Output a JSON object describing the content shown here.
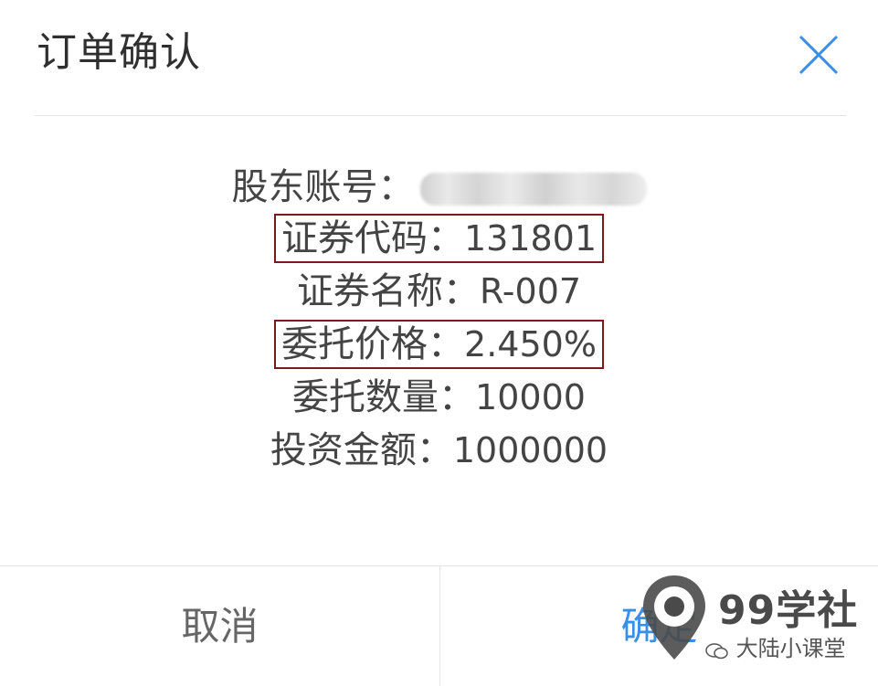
{
  "dialog": {
    "title": "订单确认",
    "close_icon": "close-icon",
    "accent_color": "#3a8ee6",
    "highlight_border_color": "#7a1a1a"
  },
  "order": {
    "account": {
      "label": "股东账号：",
      "value": "0001230707"
    },
    "code": {
      "label": "证券代码：",
      "value": "131801"
    },
    "name": {
      "label": "证券名称：",
      "value": "R-007"
    },
    "price": {
      "label": "委托价格：",
      "value": "2.450%"
    },
    "quantity": {
      "label": "委托数量：",
      "value": "10000"
    },
    "amount": {
      "label": "投资金额：",
      "value": "1000000"
    }
  },
  "buttons": {
    "cancel_label": "取消",
    "confirm_label": "确定"
  },
  "watermark": {
    "brand": "99学社",
    "sub": "大陆小课堂",
    "icon": "location-pin-icon"
  }
}
